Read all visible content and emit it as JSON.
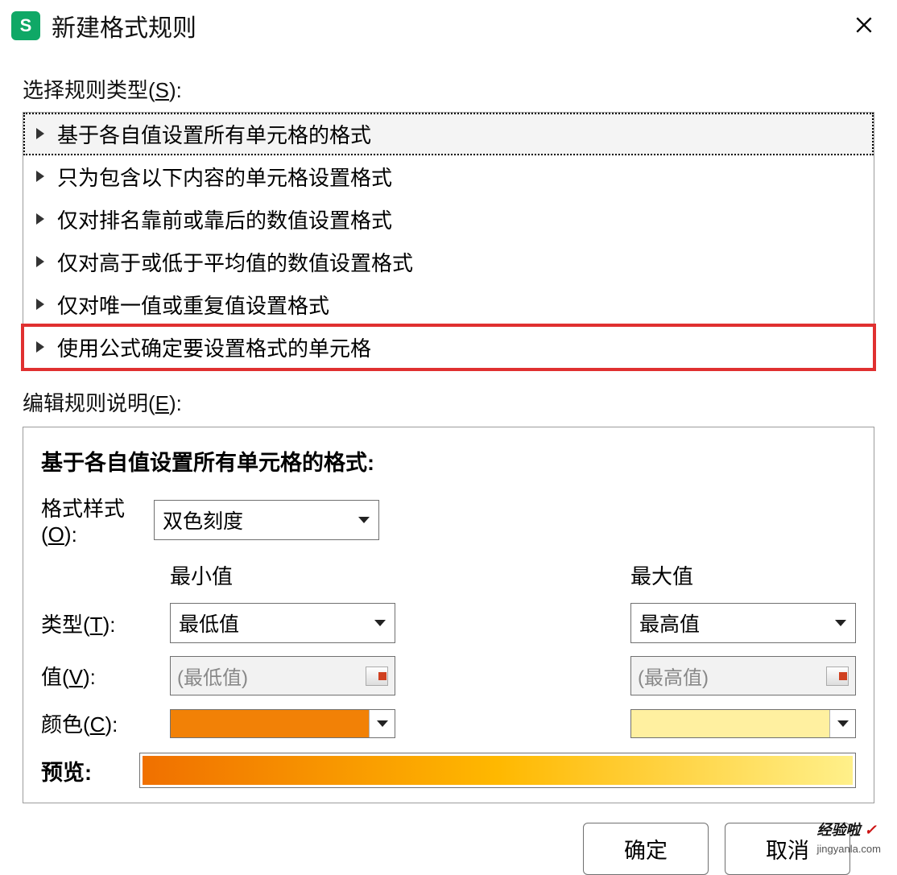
{
  "titlebar": {
    "app_icon_letter": "S",
    "title": "新建格式规则"
  },
  "sections": {
    "select_rule_type_label": "选择规则类型(",
    "select_rule_type_key": "S",
    "select_rule_type_suffix": "):",
    "edit_rule_desc_label": "编辑规则说明(",
    "edit_rule_desc_key": "E",
    "edit_rule_desc_suffix": "):"
  },
  "rule_types": [
    "基于各自值设置所有单元格的格式",
    "只为包含以下内容的单元格设置格式",
    "仅对排名靠前或靠后的数值设置格式",
    "仅对高于或低于平均值的数值设置格式",
    "仅对唯一值或重复值设置格式",
    "使用公式确定要设置格式的单元格"
  ],
  "panel": {
    "heading": "基于各自值设置所有单元格的格式:",
    "style_label": "格式样式(",
    "style_key": "O",
    "style_suffix": "):",
    "style_value": "双色刻度",
    "min_header": "最小值",
    "max_header": "最大值",
    "type_label": "类型(",
    "type_key": "T",
    "type_suffix": "):",
    "type_min": "最低值",
    "type_max": "最高值",
    "value_label": "值(",
    "value_key": "V",
    "value_suffix": "):",
    "value_min_placeholder": "(最低值)",
    "value_max_placeholder": "(最高值)",
    "color_label": "颜色(",
    "color_key": "C",
    "color_suffix": "):",
    "preview_label": "预览:"
  },
  "buttons": {
    "ok": "确定",
    "cancel": "取消"
  },
  "watermark": {
    "main": "经验啦",
    "check": "✓",
    "sub": "jingyanla.com"
  },
  "colors": {
    "orange": "#f28106",
    "yellow": "#fff0a0"
  }
}
